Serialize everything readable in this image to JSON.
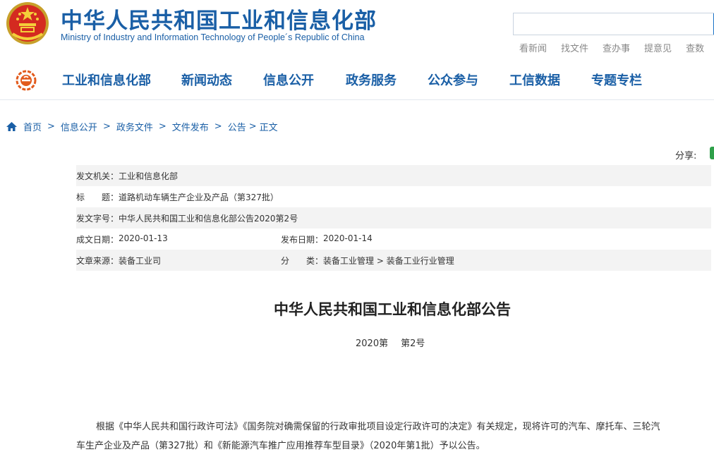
{
  "header": {
    "title": "中华人民共和国工业和信息化部",
    "subtitle": "Ministry of Industry and Information Technology of People´s Republic of China",
    "search_placeholder": "",
    "quick_links": [
      "看新闻",
      "找文件",
      "查办事",
      "提意见",
      "查数"
    ]
  },
  "nav": {
    "items": [
      "工业和信息化部",
      "新闻动态",
      "信息公开",
      "政务服务",
      "公众参与",
      "工信数据",
      "专题专栏"
    ]
  },
  "breadcrumb": [
    "首页",
    "信息公开",
    "政务文件",
    "文件发布",
    "公告",
    "正文"
  ],
  "share_label": "分享:",
  "meta": {
    "issuer_label": "发文机关：",
    "issuer": "工业和信息化部",
    "title_label": "标　　题：",
    "title": "道路机动车辆生产企业及产品（第327批）",
    "doc_no_label": "发文字号：",
    "doc_no": "中华人民共和国工业和信息化部公告2020第2号",
    "created_label": "成文日期：",
    "created": "2020-01-13",
    "published_label": "发布日期：",
    "published": "2020-01-14",
    "source_label": "文章来源：",
    "source": "装备工业司",
    "category_label": "分　　类：",
    "category": "装备工业管理 > 装备工业行业管理"
  },
  "article": {
    "title": "中华人民共和国工业和信息化部公告",
    "year": "2020第",
    "number": "第2号",
    "para1_line1": "根据《中华人民共和国行政许可法》《国务院对确需保留的行政审批项目设定行政许可的决定》有关规定，现将许可的汽车、摩托车、三轮汽",
    "para1_line2": "车生产企业及产品（第327批）和《新能源汽车推广应用推荐车型目录》（2020年第1批）予以公告。"
  },
  "colors": {
    "brand_blue": "#1a5fa6",
    "search_button": "#1a73c7",
    "row_shade": "#f3f3f3"
  }
}
